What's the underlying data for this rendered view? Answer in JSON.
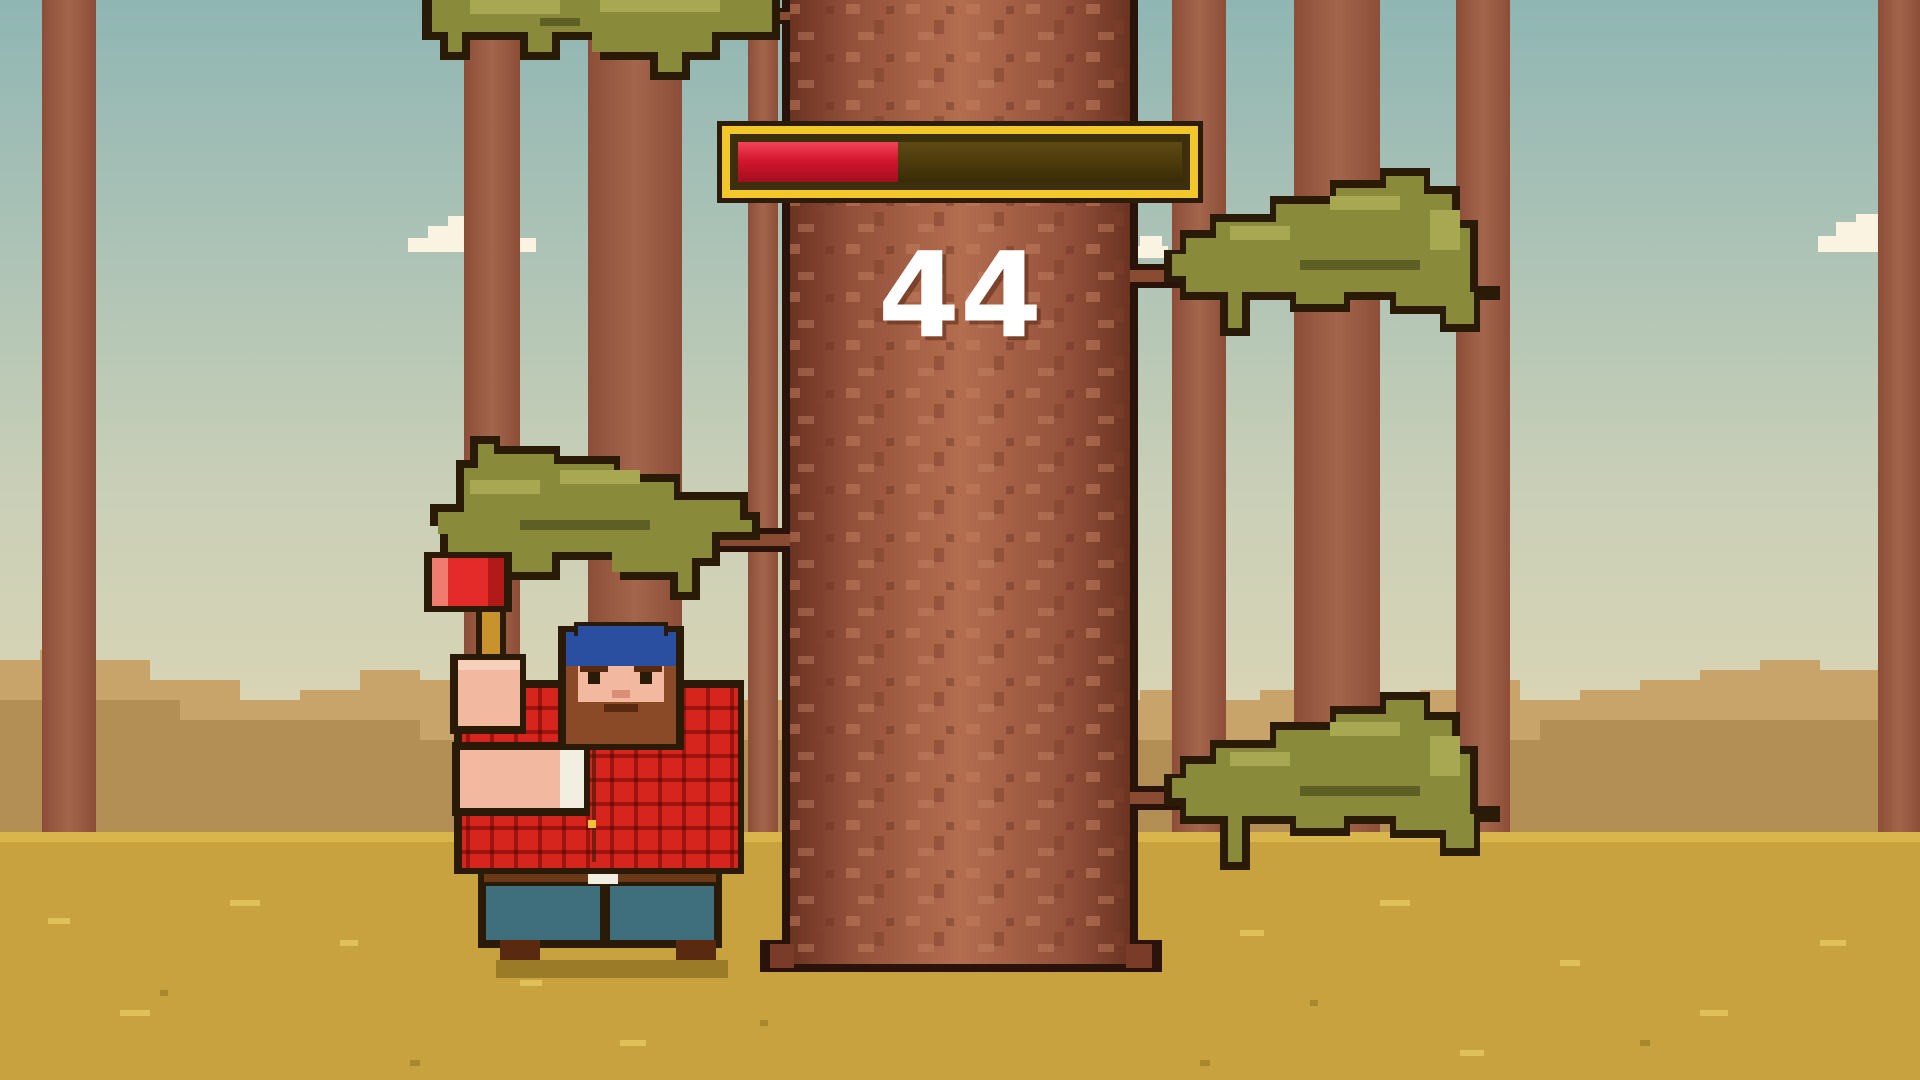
{
  "game": {
    "score": "44",
    "timer": {
      "fraction": 0.36,
      "fill_color": "#d3162d",
      "frame_color": "#f3c62c"
    },
    "player": {
      "side": "left",
      "item": "axe"
    },
    "branches": [
      {
        "side": "left",
        "level": "top"
      },
      {
        "side": "right",
        "level": "upper"
      },
      {
        "side": "left",
        "level": "middle"
      },
      {
        "side": "right",
        "level": "lower"
      }
    ],
    "colors": {
      "sky_top": "#8fb6b4",
      "sky_bottom": "#f3ddb0",
      "hills": "#c9a46a",
      "ground": "#c7a23e",
      "trunk": "#a0583b",
      "leaf": "#8a8b3a",
      "shirt": "#d6251c"
    }
  }
}
